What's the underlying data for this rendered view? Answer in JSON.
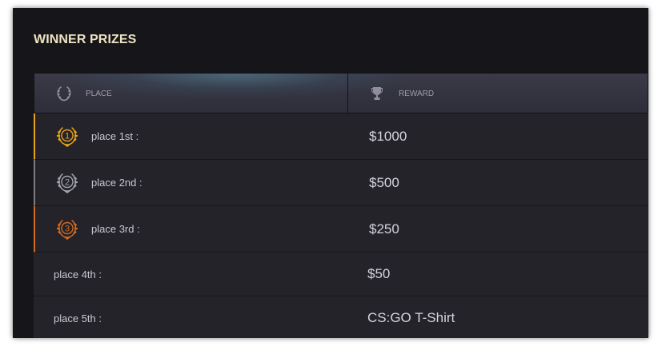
{
  "title": "WINNER PRIZES",
  "header": {
    "place_label": "PLACE",
    "reward_label": "REWARD",
    "place_icon": "laurel-wreath-icon",
    "reward_icon": "trophy-icon"
  },
  "colors": {
    "gold": "#e6a21a",
    "silver": "#9a9aa4",
    "bronze": "#d36a22",
    "title": "#efe3c4"
  },
  "prizes": [
    {
      "place": "place 1st :",
      "reward": "$1000",
      "medal_number": "1",
      "tier": "gold"
    },
    {
      "place": "place 2nd :",
      "reward": "$500",
      "medal_number": "2",
      "tier": "silver"
    },
    {
      "place": "place 3rd :",
      "reward": "$250",
      "medal_number": "3",
      "tier": "bronze"
    },
    {
      "place": "place 4th :",
      "reward": "$50"
    },
    {
      "place": "place 5th :",
      "reward": "CS:GO T-Shirt"
    }
  ]
}
